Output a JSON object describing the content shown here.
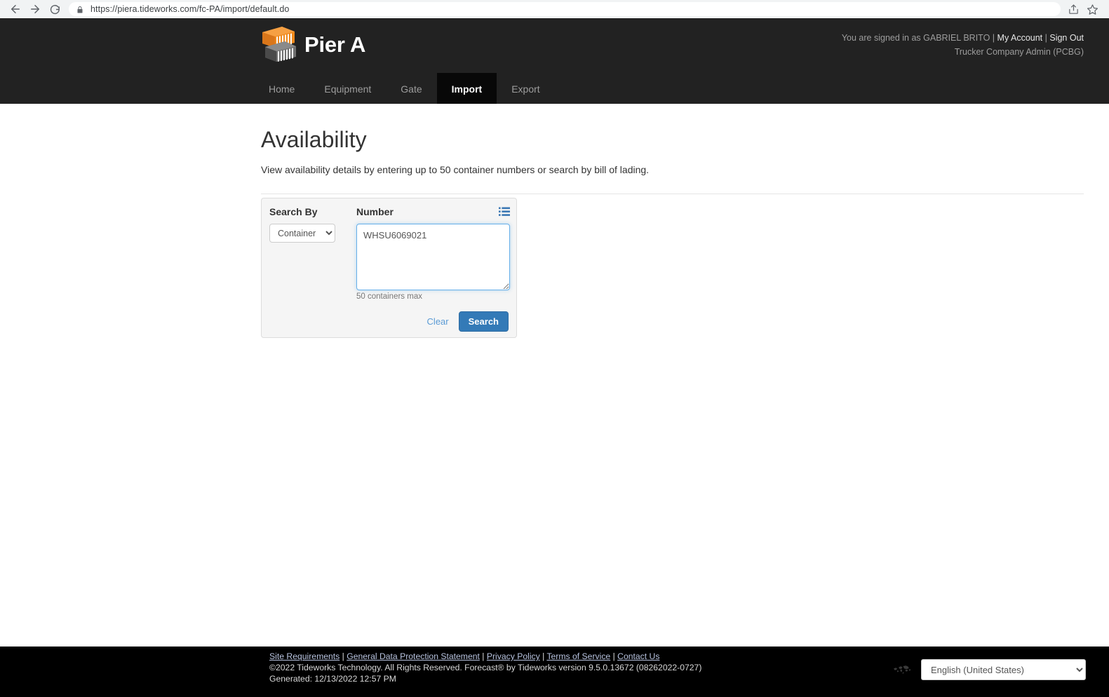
{
  "browser": {
    "url": "https://piera.tideworks.com/fc-PA/import/default.do",
    "back_label": "Back",
    "forward_label": "Forward",
    "reload_label": "Reload",
    "lock_label": "Site information",
    "share_label": "Share this page",
    "bookmark_label": "Bookmark this tab"
  },
  "header": {
    "brand_name": "Pier A",
    "signed_in_prefix": "You are signed in as GABRIEL BRITO",
    "separator": " | ",
    "my_account": "My Account",
    "sign_out": "Sign Out",
    "role": "Trucker Company Admin (PCBG)",
    "nav": [
      {
        "label": "Home",
        "active": false
      },
      {
        "label": "Equipment",
        "active": false
      },
      {
        "label": "Gate",
        "active": false
      },
      {
        "label": "Import",
        "active": true
      },
      {
        "label": "Export",
        "active": false
      }
    ]
  },
  "main": {
    "title": "Availability",
    "subtitle": "View availability details by entering up to 50 container numbers or search by bill of lading.",
    "search_panel": {
      "search_by_label": "Search By",
      "number_label": "Number",
      "list_icon": "list-icon",
      "search_by_value": "Container",
      "search_by_options": [
        "Container"
      ],
      "numbers_value": "WHSU6069021",
      "numbers_placeholder": "",
      "helper_text": "50 containers max",
      "clear_label": "Clear",
      "search_label": "Search"
    }
  },
  "footer": {
    "links": [
      "Site Requirements",
      "General Data Protection Statement",
      "Privacy Policy",
      "Terms of Service",
      "Contact Us"
    ],
    "link_separator": " | ",
    "copyright": "©2022 Tideworks Technology. All Rights Reserved. Forecast® by Tideworks version 9.5.0.13672 (08262022-0727)",
    "generated": "Generated: 12/13/2022 12:57 PM",
    "globe_icon": "world-map-icon",
    "language_value": "English (United States)",
    "language_options": [
      "English (United States)"
    ]
  },
  "colors": {
    "header_bg": "#222222",
    "active_tab_bg": "#080808",
    "footer_bg": "#000000",
    "logo_orange": "#f0891b",
    "logo_gray": "#575757",
    "primary_button": "#337ab7",
    "link_blue": "#5b9bd5",
    "focus_border": "#66afe9",
    "panel_bg": "#f5f5f5"
  }
}
